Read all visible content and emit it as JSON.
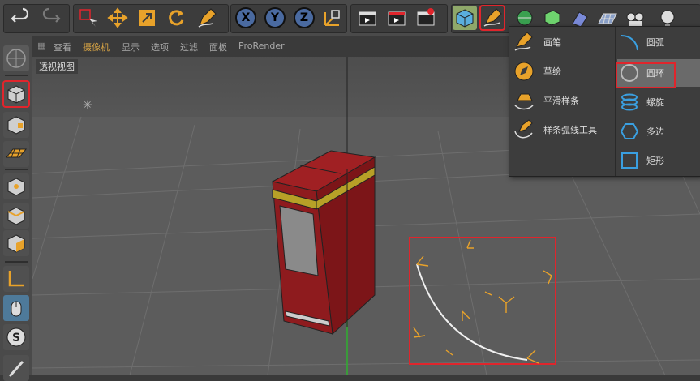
{
  "toolbar": {
    "undo_icon": "undo-icon",
    "redo_icon": "redo-icon",
    "axis_x": "X",
    "axis_y": "Y",
    "axis_z": "Z"
  },
  "viewport_menu": {
    "items": [
      "查看",
      "摄像机",
      "显示",
      "选项",
      "过滤",
      "面板",
      "ProRender"
    ]
  },
  "viewport_title": "透视视图",
  "flyout": {
    "left": [
      {
        "label": "画笔",
        "icon": "pen-icon"
      },
      {
        "label": "草绘",
        "icon": "sketch-icon"
      },
      {
        "label": "平滑样条",
        "icon": "smooth-spline-icon"
      },
      {
        "label": "样条弧线工具",
        "icon": "spline-arc-tool-icon"
      }
    ],
    "right": [
      {
        "label": "圆弧",
        "icon": "arc-icon"
      },
      {
        "label": "圆环",
        "icon": "circle-icon"
      },
      {
        "label": "螺旋",
        "icon": "helix-icon"
      },
      {
        "label": "多边",
        "icon": "polygon-icon"
      },
      {
        "label": "矩形",
        "icon": "rectangle-icon"
      }
    ],
    "highlighted": "圆环"
  },
  "colors": {
    "accent_orange": "#e8a22a",
    "highlight_red": "#e0252c",
    "spline_blue": "#3a9fe0"
  }
}
